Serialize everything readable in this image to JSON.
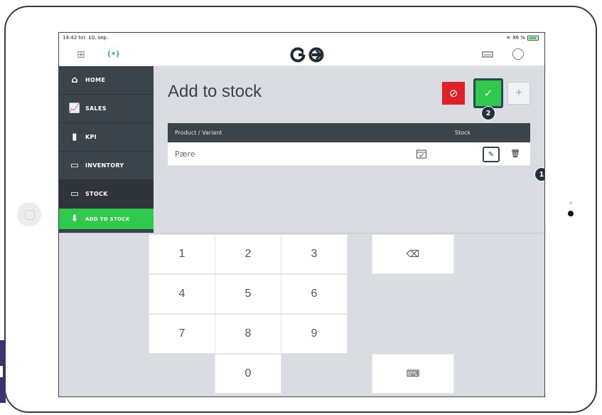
{
  "status": {
    "time_date": "14:42  tor. 10. sep.",
    "battery": "86 %"
  },
  "topbar": {
    "grid_icon": "grid-icon",
    "signal_icon": "signal-icon",
    "logo_text": "GO",
    "printer_icon": "printer-icon",
    "user_icon": "user-icon"
  },
  "sidebar": {
    "items": [
      {
        "label": "HOME",
        "icon": "home-icon"
      },
      {
        "label": "SALES",
        "icon": "chart-icon"
      },
      {
        "label": "KPI",
        "icon": "bar-icon"
      },
      {
        "label": "INVENTORY",
        "icon": "box-icon"
      },
      {
        "label": "STOCK",
        "icon": "box-icon"
      },
      {
        "label": "ADD TO STOCK",
        "icon": "box-add-icon"
      }
    ],
    "active": "ADD TO STOCK"
  },
  "main": {
    "title": "Add to stock",
    "actions": {
      "cancel_glyph": "⊘",
      "confirm_glyph": "✓",
      "add_glyph": "+"
    },
    "table": {
      "columns": [
        "Product / Variant",
        "Stock"
      ],
      "rows": [
        {
          "product": "Pære",
          "stock_value": ""
        }
      ]
    },
    "callouts": [
      "1",
      "2"
    ]
  },
  "keypad": {
    "keys": [
      "1",
      "2",
      "3",
      "4",
      "5",
      "6",
      "7",
      "8",
      "9",
      "0"
    ],
    "backspace_glyph": "⌫",
    "keyboard_glyph": "⌨"
  },
  "colors": {
    "accent_green": "#2fc94c",
    "cancel_red": "#e02029",
    "sidebar_dark": "#3c444b",
    "navy": "#2d4554"
  }
}
